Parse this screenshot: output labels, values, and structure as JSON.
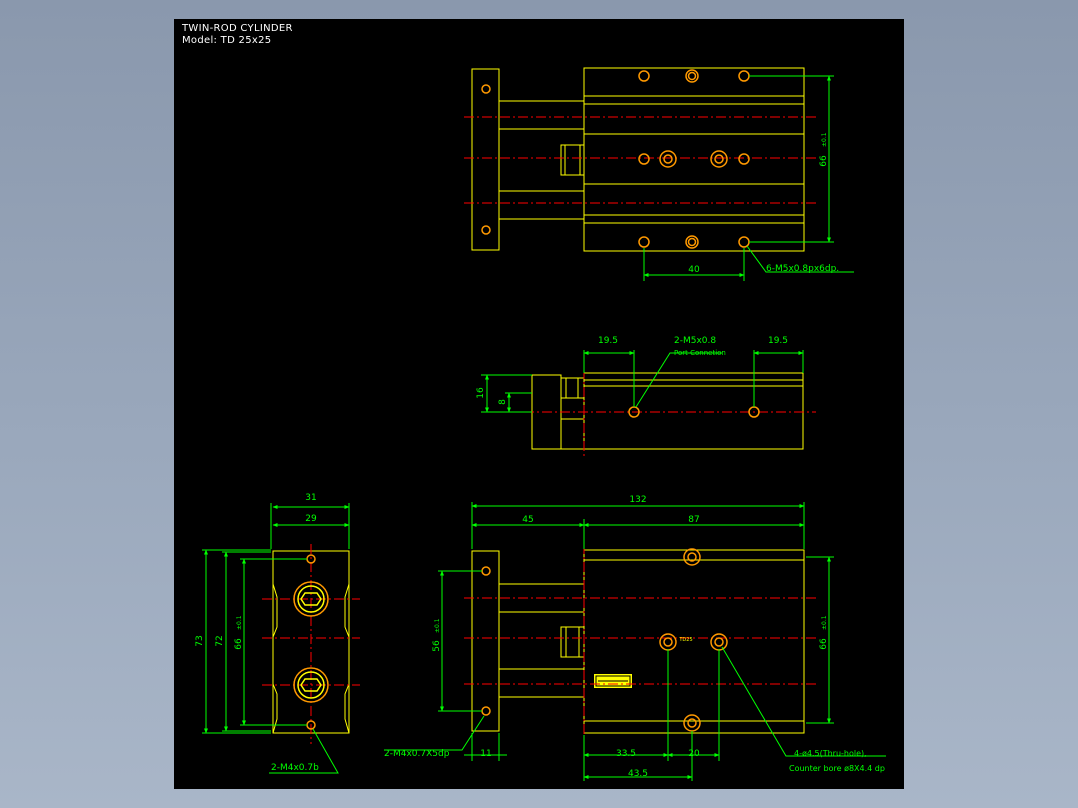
{
  "drawing": {
    "title": "TWIN-ROD CYLINDER",
    "model": "Model: TD 25x25"
  },
  "top_view": {
    "dim_66": "66",
    "tol_66": "±0.1",
    "dim_40": "40",
    "note_tapped": "6-M5x0.8px6dp."
  },
  "side_view": {
    "dim_left": "19.5",
    "dim_right": "19.5",
    "dim_16": "16",
    "dim_8": "8",
    "port_label": "2-M5x0.8",
    "port_note": "Port Connetion"
  },
  "end_view": {
    "dim_31": "31",
    "dim_29": "29",
    "dim_73": "73",
    "dim_72": "72",
    "dim_66": "66",
    "tol_66": "±0.1",
    "note_tap": "2-M4x0.7b"
  },
  "front_view": {
    "dim_132": "132",
    "dim_45": "45",
    "dim_87": "87",
    "dim_56": "56",
    "tol_56": "±0.1",
    "dim_66": "66",
    "tol_66": "±0.1",
    "dim_11": "11",
    "dim_33_5": "33.5",
    "dim_20": "20",
    "dim_43_5": "43.5",
    "note_plate_tap": "2-M4x0.7X5dp",
    "note_thru_hole": "4-ø4.5(Thru-hole),",
    "note_counter_bore": "Counter bore ø8X4.4 dp",
    "body_mark": "TD25"
  },
  "colors": {
    "background": "#000000",
    "outline": "#ffff00",
    "dimension": "#00ff00",
    "centerline": "#ff0000",
    "hole": "#ff9900",
    "window": "#8a98ad"
  }
}
